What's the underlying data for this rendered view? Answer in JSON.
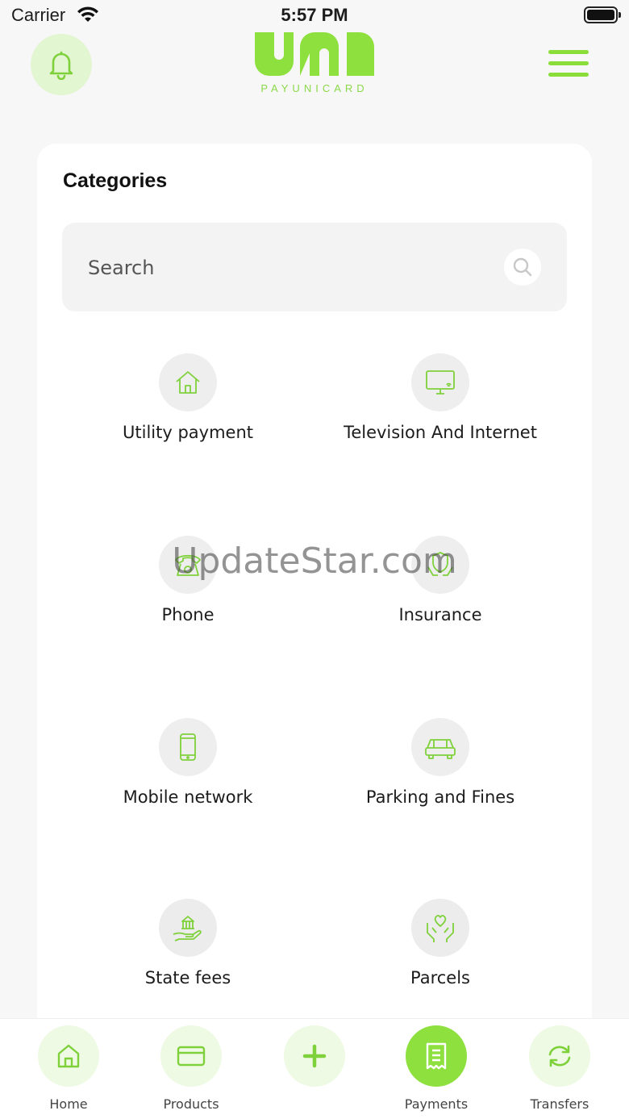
{
  "status_bar": {
    "carrier": "Carrier",
    "time": "5:57 PM"
  },
  "header": {
    "logo_text": "PAYUNICARD",
    "accent_color": "#8ee03f"
  },
  "card": {
    "title": "Categories",
    "search": {
      "placeholder": "Search"
    },
    "categories": [
      {
        "label": "Utility payment",
        "icon": "home-icon"
      },
      {
        "label": "Television And Internet",
        "icon": "monitor-icon"
      },
      {
        "label": "Phone",
        "icon": "telephone-icon"
      },
      {
        "label": "Insurance",
        "icon": "shield-hands-icon"
      },
      {
        "label": "Mobile network",
        "icon": "smartphone-icon"
      },
      {
        "label": "Parking and Fines",
        "icon": "car-icon"
      },
      {
        "label": "State fees",
        "icon": "government-hand-icon"
      },
      {
        "label": "Parcels",
        "icon": "heart-hands-icon"
      }
    ]
  },
  "watermark": "UpdateStar.com",
  "bottom_nav": {
    "items": [
      {
        "label": "Home",
        "icon": "home-icon"
      },
      {
        "label": "Products",
        "icon": "card-icon"
      },
      {
        "label": "",
        "icon": "plus-icon"
      },
      {
        "label": "Payments",
        "icon": "receipt-icon",
        "active": true
      },
      {
        "label": "Transfers",
        "icon": "refresh-icon"
      }
    ]
  }
}
